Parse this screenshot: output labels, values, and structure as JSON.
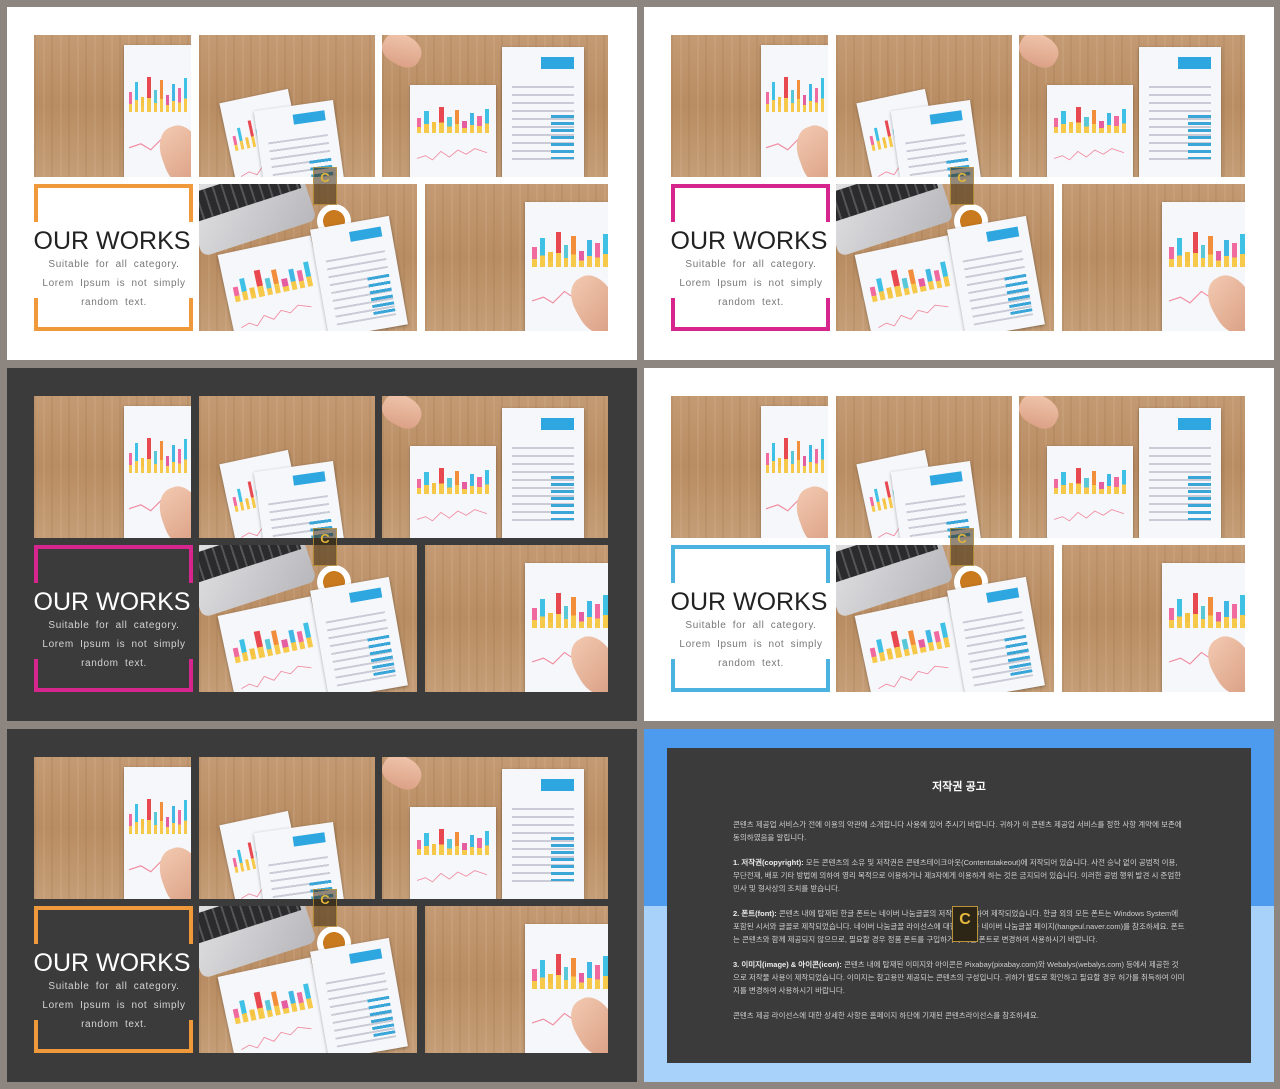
{
  "slides": [
    {
      "theme": "light",
      "accent": "#f0993a",
      "title": "OUR WORKS",
      "line1": "Suitable for all category.",
      "line2": "Lorem Ipsum is not simply",
      "line3": "random text."
    },
    {
      "theme": "light",
      "accent": "#d6268e",
      "title": "OUR WORKS",
      "line1": "Suitable for all category.",
      "line2": "Lorem Ipsum is not simply",
      "line3": "random text."
    },
    {
      "theme": "dark",
      "accent": "#d6268e",
      "title": "OUR WORKS",
      "line1": "Suitable for all category.",
      "line2": "Lorem Ipsum is not simply",
      "line3": "random text."
    },
    {
      "theme": "light",
      "accent": "#4cb3e0",
      "title": "OUR WORKS",
      "line1": "Suitable for all category.",
      "line2": "Lorem Ipsum is not simply",
      "line3": "random text."
    },
    {
      "theme": "dark",
      "accent": "#f0993a",
      "title": "OUR WORKS",
      "line1": "Suitable for all category.",
      "line2": "Lorem Ipsum is not simply",
      "line3": "random text."
    }
  ],
  "watermark_letter": "C",
  "copyright": {
    "title": "저작권 공고",
    "intro": "콘텐츠 제공업 서비스가 전에 이용의 약관에 소개합니다 사용에 있어 주시기 바랍니다. 귀하가 이 콘텐츠 제공업 서비스를 정한 사항 계약에 보존에 동의하였음을 알립니다.",
    "s1_label": "1. 저작권(copyright):",
    "s1_text": "모든 콘텐츠의 소유 및 저작권은 콘텐츠테이크아웃(Contentstakeout)에 저작되어 있습니다. 사전 승낙 없이 공범적 이용, 무단전재, 배포 기타 방법에 의하여 영리 목적으로 이용하거나 제3자에게 이용하게 하는 것은 금지되어 있습니다. 이러한 공범 행위 발견 시 준엄한 민사 및 형사상의 조치를 받습니다.",
    "s2_label": "2. 폰트(font):",
    "s2_text": "콘텐츠 내에 탑재된 한글 폰트는 네이버 나눔글꼴의 저작권을 통하여 제작되었습니다. 한글 외의 모든 폰트는 Windows System에 포함된 시서와 글꼴로 제작되었습니다. 네이버 나눔글꼴 라이선스에 대한 사항은 네이버 나눔글꼴 페이지(hangeul.naver.com)를 참조하세요. 폰트는 콘텐츠와 함께 제공되지 않으므로, 필요할 경우 정품 폰트를 구입하거나 다른 폰트로 변경하여 사용하시기 바랍니다.",
    "s3_label": "3. 이미지(image) & 아이콘(icon):",
    "s3_text": "콘텐츠 내에 탑재된 이미지와 아이콘은 Pixabay(pixabay.com)와 Webalys(webalys.com) 등에서 제공한 것으로 저작물 사용이 제작되었습니다. 이미지는 참고용만 제공되는 콘텐츠의 구성입니다. 귀하가 별도로 확인하고 필요할 경우 허가를 취득하여 이미지를 변경하여 사용하시기 바랍니다.",
    "outro": "콘텐츠 제공 라이선스에 대한 상세한 사항은 홈페이지 하단에 기재된 콘텐츠라이선스를 참조하세요."
  }
}
